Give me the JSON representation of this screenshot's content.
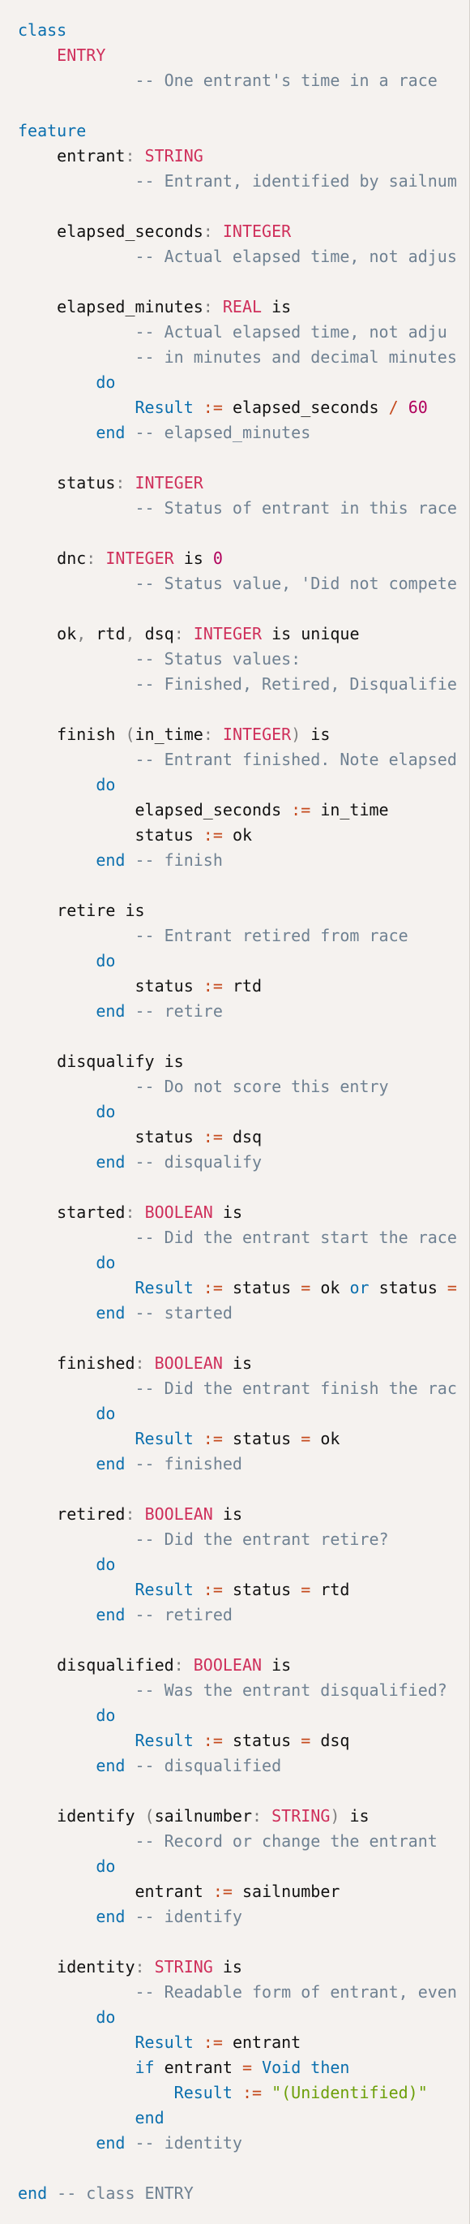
{
  "editor": {
    "background": "#f5f2ef",
    "colors": {
      "keyword": "#0b6fae",
      "type": "#cf2f5b",
      "comment": "#6f8192",
      "number": "#b0005c",
      "string": "#6c9f08",
      "operator": "#c54a1d",
      "identifier": "#111111"
    },
    "lines": [
      [
        [
          "kw",
          "class"
        ]
      ],
      [
        [
          "ws",
          "    "
        ],
        [
          "type",
          "ENTRY"
        ]
      ],
      [
        [
          "ws",
          "            "
        ],
        [
          "cm",
          "-- One entrant's time in a race"
        ]
      ],
      [],
      [
        [
          "kw",
          "feature"
        ]
      ],
      [
        [
          "ws",
          "    "
        ],
        [
          "id",
          "entrant"
        ],
        [
          "pu",
          ": "
        ],
        [
          "type",
          "STRING"
        ]
      ],
      [
        [
          "ws",
          "            "
        ],
        [
          "cm",
          "-- Entrant, identified by sailnum"
        ]
      ],
      [],
      [
        [
          "ws",
          "    "
        ],
        [
          "id",
          "elapsed_seconds"
        ],
        [
          "pu",
          ": "
        ],
        [
          "type",
          "INTEGER"
        ]
      ],
      [
        [
          "ws",
          "            "
        ],
        [
          "cm",
          "-- Actual elapsed time, not adjus"
        ]
      ],
      [],
      [
        [
          "ws",
          "    "
        ],
        [
          "id",
          "elapsed_minutes"
        ],
        [
          "pu",
          ": "
        ],
        [
          "type",
          "REAL"
        ],
        [
          "ws",
          " "
        ],
        [
          "id",
          "is"
        ]
      ],
      [
        [
          "ws",
          "            "
        ],
        [
          "cm",
          "-- Actual elapsed time, not adju"
        ]
      ],
      [
        [
          "ws",
          "            "
        ],
        [
          "cm",
          "-- in minutes and decimal minutes"
        ]
      ],
      [
        [
          "ws",
          "        "
        ],
        [
          "kw",
          "do"
        ]
      ],
      [
        [
          "ws",
          "            "
        ],
        [
          "kw",
          "Result"
        ],
        [
          "ws",
          " "
        ],
        [
          "op",
          ":="
        ],
        [
          "ws",
          " "
        ],
        [
          "id",
          "elapsed_seconds"
        ],
        [
          "ws",
          " "
        ],
        [
          "op",
          "/"
        ],
        [
          "ws",
          " "
        ],
        [
          "num",
          "60"
        ]
      ],
      [
        [
          "ws",
          "        "
        ],
        [
          "kw",
          "end"
        ],
        [
          "ws",
          " "
        ],
        [
          "cm",
          "-- elapsed_minutes"
        ]
      ],
      [],
      [
        [
          "ws",
          "    "
        ],
        [
          "id",
          "status"
        ],
        [
          "pu",
          ": "
        ],
        [
          "type",
          "INTEGER"
        ]
      ],
      [
        [
          "ws",
          "            "
        ],
        [
          "cm",
          "-- Status of entrant in this race"
        ]
      ],
      [],
      [
        [
          "ws",
          "    "
        ],
        [
          "id",
          "dnc"
        ],
        [
          "pu",
          ": "
        ],
        [
          "type",
          "INTEGER"
        ],
        [
          "ws",
          " "
        ],
        [
          "id",
          "is"
        ],
        [
          "ws",
          " "
        ],
        [
          "num",
          "0"
        ]
      ],
      [
        [
          "ws",
          "            "
        ],
        [
          "cm",
          "-- Status value, 'Did not compete"
        ]
      ],
      [],
      [
        [
          "ws",
          "    "
        ],
        [
          "id",
          "ok"
        ],
        [
          "pu",
          ", "
        ],
        [
          "id",
          "rtd"
        ],
        [
          "pu",
          ", "
        ],
        [
          "id",
          "dsq"
        ],
        [
          "pu",
          ": "
        ],
        [
          "type",
          "INTEGER"
        ],
        [
          "ws",
          " "
        ],
        [
          "id",
          "is unique"
        ]
      ],
      [
        [
          "ws",
          "            "
        ],
        [
          "cm",
          "-- Status values:"
        ]
      ],
      [
        [
          "ws",
          "            "
        ],
        [
          "cm",
          "-- Finished, Retired, Disqualifie"
        ]
      ],
      [],
      [
        [
          "ws",
          "    "
        ],
        [
          "id",
          "finish"
        ],
        [
          "ws",
          " "
        ],
        [
          "pu",
          "("
        ],
        [
          "id",
          "in_time"
        ],
        [
          "pu",
          ": "
        ],
        [
          "type",
          "INTEGER"
        ],
        [
          "pu",
          ")"
        ],
        [
          "ws",
          " "
        ],
        [
          "id",
          "is"
        ]
      ],
      [
        [
          "ws",
          "            "
        ],
        [
          "cm",
          "-- Entrant finished. Note elapsed"
        ]
      ],
      [
        [
          "ws",
          "        "
        ],
        [
          "kw",
          "do"
        ]
      ],
      [
        [
          "ws",
          "            "
        ],
        [
          "id",
          "elapsed_seconds"
        ],
        [
          "ws",
          " "
        ],
        [
          "op",
          ":="
        ],
        [
          "ws",
          " "
        ],
        [
          "id",
          "in_time"
        ]
      ],
      [
        [
          "ws",
          "            "
        ],
        [
          "id",
          "status"
        ],
        [
          "ws",
          " "
        ],
        [
          "op",
          ":="
        ],
        [
          "ws",
          " "
        ],
        [
          "id",
          "ok"
        ]
      ],
      [
        [
          "ws",
          "        "
        ],
        [
          "kw",
          "end"
        ],
        [
          "ws",
          " "
        ],
        [
          "cm",
          "-- finish"
        ]
      ],
      [],
      [
        [
          "ws",
          "    "
        ],
        [
          "id",
          "retire is"
        ]
      ],
      [
        [
          "ws",
          "            "
        ],
        [
          "cm",
          "-- Entrant retired from race"
        ]
      ],
      [
        [
          "ws",
          "        "
        ],
        [
          "kw",
          "do"
        ]
      ],
      [
        [
          "ws",
          "            "
        ],
        [
          "id",
          "status"
        ],
        [
          "ws",
          " "
        ],
        [
          "op",
          ":="
        ],
        [
          "ws",
          " "
        ],
        [
          "id",
          "rtd"
        ]
      ],
      [
        [
          "ws",
          "        "
        ],
        [
          "kw",
          "end"
        ],
        [
          "ws",
          " "
        ],
        [
          "cm",
          "-- retire"
        ]
      ],
      [],
      [
        [
          "ws",
          "    "
        ],
        [
          "id",
          "disqualify is"
        ]
      ],
      [
        [
          "ws",
          "            "
        ],
        [
          "cm",
          "-- Do not score this entry"
        ]
      ],
      [
        [
          "ws",
          "        "
        ],
        [
          "kw",
          "do"
        ]
      ],
      [
        [
          "ws",
          "            "
        ],
        [
          "id",
          "status"
        ],
        [
          "ws",
          " "
        ],
        [
          "op",
          ":="
        ],
        [
          "ws",
          " "
        ],
        [
          "id",
          "dsq"
        ]
      ],
      [
        [
          "ws",
          "        "
        ],
        [
          "kw",
          "end"
        ],
        [
          "ws",
          " "
        ],
        [
          "cm",
          "-- disqualify"
        ]
      ],
      [],
      [
        [
          "ws",
          "    "
        ],
        [
          "id",
          "started"
        ],
        [
          "pu",
          ": "
        ],
        [
          "type",
          "BOOLEAN"
        ],
        [
          "ws",
          " "
        ],
        [
          "id",
          "is"
        ]
      ],
      [
        [
          "ws",
          "            "
        ],
        [
          "cm",
          "-- Did the entrant start the race"
        ]
      ],
      [
        [
          "ws",
          "        "
        ],
        [
          "kw",
          "do"
        ]
      ],
      [
        [
          "ws",
          "            "
        ],
        [
          "kw",
          "Result"
        ],
        [
          "ws",
          " "
        ],
        [
          "op",
          ":="
        ],
        [
          "ws",
          " "
        ],
        [
          "id",
          "status"
        ],
        [
          "ws",
          " "
        ],
        [
          "op",
          "="
        ],
        [
          "ws",
          " "
        ],
        [
          "id",
          "ok"
        ],
        [
          "ws",
          " "
        ],
        [
          "kw",
          "or"
        ],
        [
          "ws",
          " "
        ],
        [
          "id",
          "status"
        ],
        [
          "ws",
          " "
        ],
        [
          "op",
          "="
        ]
      ],
      [
        [
          "ws",
          "        "
        ],
        [
          "kw",
          "end"
        ],
        [
          "ws",
          " "
        ],
        [
          "cm",
          "-- started"
        ]
      ],
      [],
      [
        [
          "ws",
          "    "
        ],
        [
          "id",
          "finished"
        ],
        [
          "pu",
          ": "
        ],
        [
          "type",
          "BOOLEAN"
        ],
        [
          "ws",
          " "
        ],
        [
          "id",
          "is"
        ]
      ],
      [
        [
          "ws",
          "            "
        ],
        [
          "cm",
          "-- Did the entrant finish the rac"
        ]
      ],
      [
        [
          "ws",
          "        "
        ],
        [
          "kw",
          "do"
        ]
      ],
      [
        [
          "ws",
          "            "
        ],
        [
          "kw",
          "Result"
        ],
        [
          "ws",
          " "
        ],
        [
          "op",
          ":="
        ],
        [
          "ws",
          " "
        ],
        [
          "id",
          "status"
        ],
        [
          "ws",
          " "
        ],
        [
          "op",
          "="
        ],
        [
          "ws",
          " "
        ],
        [
          "id",
          "ok"
        ]
      ],
      [
        [
          "ws",
          "        "
        ],
        [
          "kw",
          "end"
        ],
        [
          "ws",
          " "
        ],
        [
          "cm",
          "-- finished"
        ]
      ],
      [],
      [
        [
          "ws",
          "    "
        ],
        [
          "id",
          "retired"
        ],
        [
          "pu",
          ": "
        ],
        [
          "type",
          "BOOLEAN"
        ],
        [
          "ws",
          " "
        ],
        [
          "id",
          "is"
        ]
      ],
      [
        [
          "ws",
          "            "
        ],
        [
          "cm",
          "-- Did the entrant retire?"
        ]
      ],
      [
        [
          "ws",
          "        "
        ],
        [
          "kw",
          "do"
        ]
      ],
      [
        [
          "ws",
          "            "
        ],
        [
          "kw",
          "Result"
        ],
        [
          "ws",
          " "
        ],
        [
          "op",
          ":="
        ],
        [
          "ws",
          " "
        ],
        [
          "id",
          "status"
        ],
        [
          "ws",
          " "
        ],
        [
          "op",
          "="
        ],
        [
          "ws",
          " "
        ],
        [
          "id",
          "rtd"
        ]
      ],
      [
        [
          "ws",
          "        "
        ],
        [
          "kw",
          "end"
        ],
        [
          "ws",
          " "
        ],
        [
          "cm",
          "-- retired"
        ]
      ],
      [],
      [
        [
          "ws",
          "    "
        ],
        [
          "id",
          "disqualified"
        ],
        [
          "pu",
          ": "
        ],
        [
          "type",
          "BOOLEAN"
        ],
        [
          "ws",
          " "
        ],
        [
          "id",
          "is"
        ]
      ],
      [
        [
          "ws",
          "            "
        ],
        [
          "cm",
          "-- Was the entrant disqualified?"
        ]
      ],
      [
        [
          "ws",
          "        "
        ],
        [
          "kw",
          "do"
        ]
      ],
      [
        [
          "ws",
          "            "
        ],
        [
          "kw",
          "Result"
        ],
        [
          "ws",
          " "
        ],
        [
          "op",
          ":="
        ],
        [
          "ws",
          " "
        ],
        [
          "id",
          "status"
        ],
        [
          "ws",
          " "
        ],
        [
          "op",
          "="
        ],
        [
          "ws",
          " "
        ],
        [
          "id",
          "dsq"
        ]
      ],
      [
        [
          "ws",
          "        "
        ],
        [
          "kw",
          "end"
        ],
        [
          "ws",
          " "
        ],
        [
          "cm",
          "-- disqualified"
        ]
      ],
      [],
      [
        [
          "ws",
          "    "
        ],
        [
          "id",
          "identify"
        ],
        [
          "ws",
          " "
        ],
        [
          "pu",
          "("
        ],
        [
          "id",
          "sailnumber"
        ],
        [
          "pu",
          ": "
        ],
        [
          "type",
          "STRING"
        ],
        [
          "pu",
          ")"
        ],
        [
          "ws",
          " "
        ],
        [
          "id",
          "is"
        ]
      ],
      [
        [
          "ws",
          "            "
        ],
        [
          "cm",
          "-- Record or change the entrant"
        ]
      ],
      [
        [
          "ws",
          "        "
        ],
        [
          "kw",
          "do"
        ]
      ],
      [
        [
          "ws",
          "            "
        ],
        [
          "id",
          "entrant"
        ],
        [
          "ws",
          " "
        ],
        [
          "op",
          ":="
        ],
        [
          "ws",
          " "
        ],
        [
          "id",
          "sailnumber"
        ]
      ],
      [
        [
          "ws",
          "        "
        ],
        [
          "kw",
          "end"
        ],
        [
          "ws",
          " "
        ],
        [
          "cm",
          "-- identify"
        ]
      ],
      [],
      [
        [
          "ws",
          "    "
        ],
        [
          "id",
          "identity"
        ],
        [
          "pu",
          ": "
        ],
        [
          "type",
          "STRING"
        ],
        [
          "ws",
          " "
        ],
        [
          "id",
          "is"
        ]
      ],
      [
        [
          "ws",
          "            "
        ],
        [
          "cm",
          "-- Readable form of entrant, even"
        ]
      ],
      [
        [
          "ws",
          "        "
        ],
        [
          "kw",
          "do"
        ]
      ],
      [
        [
          "ws",
          "            "
        ],
        [
          "kw",
          "Result"
        ],
        [
          "ws",
          " "
        ],
        [
          "op",
          ":="
        ],
        [
          "ws",
          " "
        ],
        [
          "id",
          "entrant"
        ]
      ],
      [
        [
          "ws",
          "            "
        ],
        [
          "kw",
          "if"
        ],
        [
          "ws",
          " "
        ],
        [
          "id",
          "entrant"
        ],
        [
          "ws",
          " "
        ],
        [
          "op",
          "="
        ],
        [
          "ws",
          " "
        ],
        [
          "kw",
          "Void"
        ],
        [
          "ws",
          " "
        ],
        [
          "kw",
          "then"
        ]
      ],
      [
        [
          "ws",
          "                "
        ],
        [
          "kw",
          "Result"
        ],
        [
          "ws",
          " "
        ],
        [
          "op",
          ":="
        ],
        [
          "ws",
          " "
        ],
        [
          "str",
          "\"(Unidentified)\""
        ]
      ],
      [
        [
          "ws",
          "            "
        ],
        [
          "kw",
          "end"
        ]
      ],
      [
        [
          "ws",
          "        "
        ],
        [
          "kw",
          "end"
        ],
        [
          "ws",
          " "
        ],
        [
          "cm",
          "-- identity"
        ]
      ],
      [],
      [
        [
          "kw",
          "end"
        ],
        [
          "ws",
          " "
        ],
        [
          "cm",
          "-- class ENTRY"
        ]
      ]
    ]
  }
}
